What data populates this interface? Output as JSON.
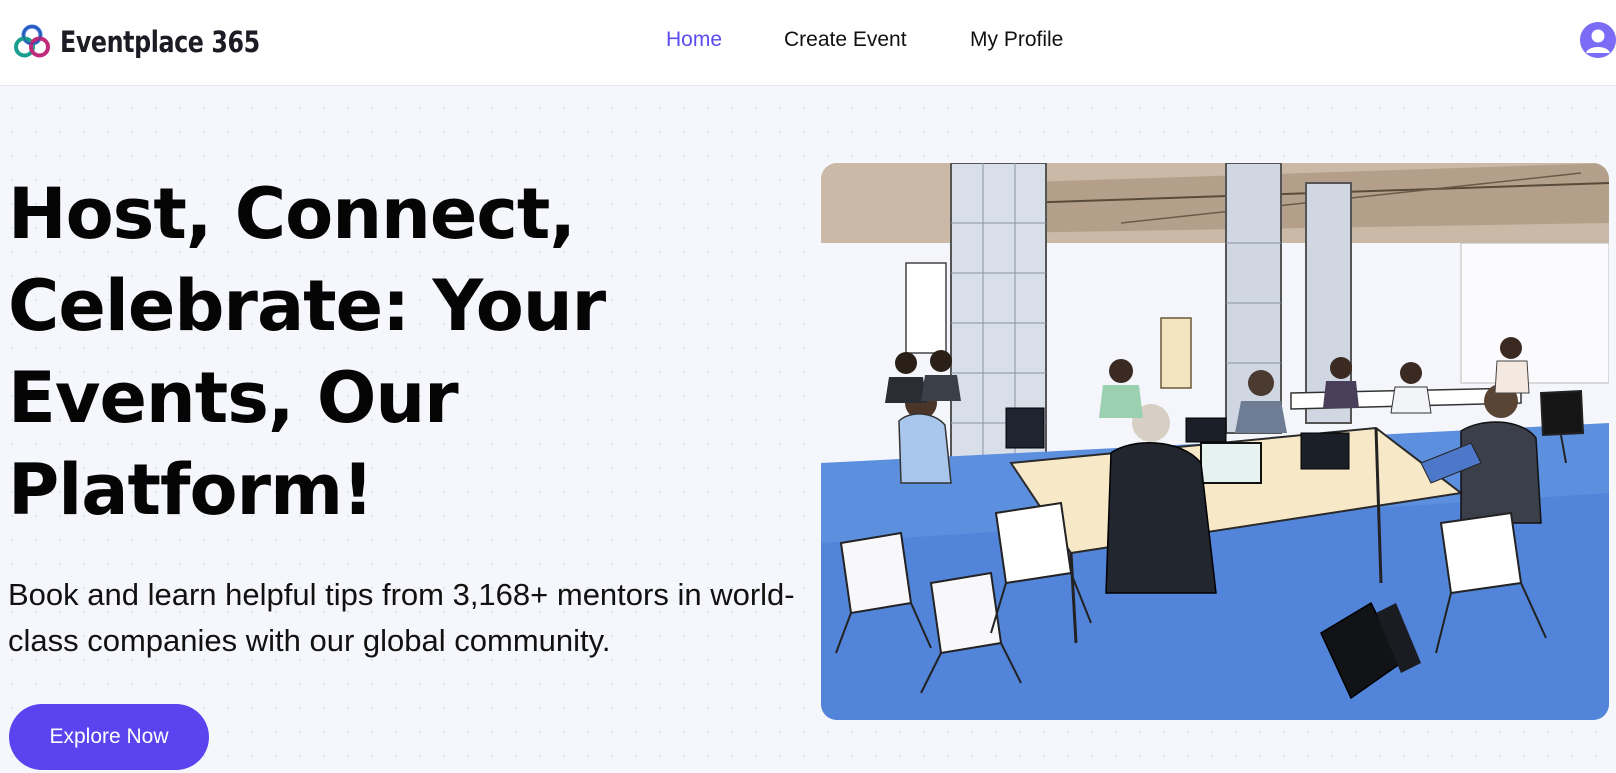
{
  "brand": {
    "name": "Eventplace 365",
    "logo_icon": "interlocking-rings-logo"
  },
  "nav": {
    "items": [
      {
        "label": "Home",
        "active": true
      },
      {
        "label": "Create Event",
        "active": false
      },
      {
        "label": "My Profile",
        "active": false
      }
    ],
    "avatar_icon": "user-avatar-icon"
  },
  "hero": {
    "title": "Host, Connect, Celebrate: Your Events, Our Platform!",
    "subtitle": "Book and learn helpful tips from 3,168+ mentors in world-class companies with our global community.",
    "cta_label": "Explore Now",
    "image_subject": "people-working-in-coworking-space"
  },
  "colors": {
    "accent": "#5b44ef",
    "active_link": "#5b4cf0",
    "background": "#f6f7fc",
    "text": "#050505"
  }
}
